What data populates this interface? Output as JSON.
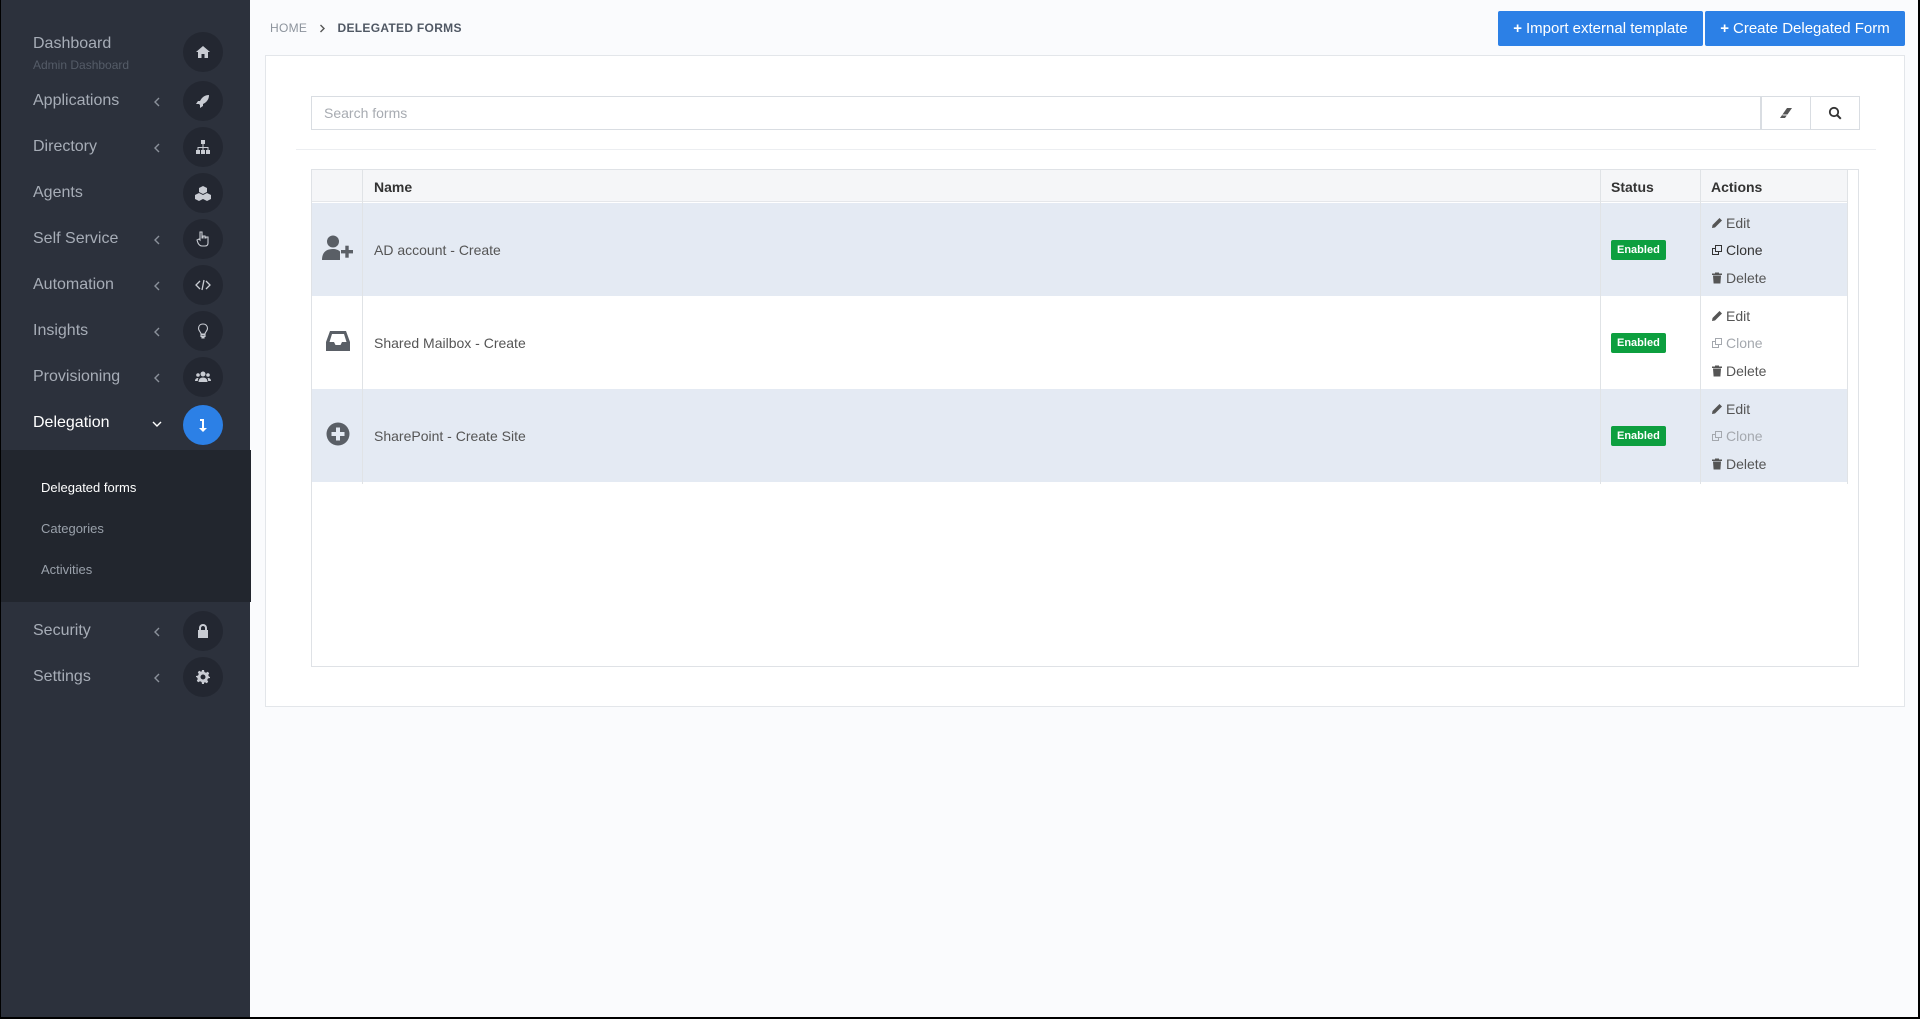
{
  "sidebar": {
    "dashboard": {
      "label": "Dashboard",
      "sub": "Admin Dashboard"
    },
    "items": [
      {
        "label": "Applications",
        "icon": "rocket-icon"
      },
      {
        "label": "Directory",
        "icon": "sitemap-icon"
      },
      {
        "label": "Agents",
        "icon": "cubes-icon"
      },
      {
        "label": "Self Service",
        "icon": "hand-pointer-icon"
      },
      {
        "label": "Automation",
        "icon": "code-icon"
      },
      {
        "label": "Insights",
        "icon": "lightbulb-icon"
      },
      {
        "label": "Provisioning",
        "icon": "users-icon"
      },
      {
        "label": "Delegation",
        "icon": "level-down-icon"
      },
      {
        "label": "Security",
        "icon": "lock-icon"
      },
      {
        "label": "Settings",
        "icon": "gear-icon"
      }
    ],
    "submenu": [
      "Delegated forms",
      "Categories",
      "Activities"
    ]
  },
  "breadcrumb": {
    "home": "HOME",
    "current": "DELEGATED FORMS"
  },
  "buttons": {
    "import": "Import external template",
    "create": "Create Delegated Form"
  },
  "search": {
    "placeholder": "Search forms",
    "value": ""
  },
  "table": {
    "headers": {
      "name": "Name",
      "status": "Status",
      "actions": "Actions"
    },
    "rows": [
      {
        "name": "AD account - Create",
        "status": "Enabled",
        "icon": "user-plus-icon",
        "clone_enabled": true
      },
      {
        "name": "Shared Mailbox - Create",
        "status": "Enabled",
        "icon": "inbox-icon",
        "clone_enabled": false
      },
      {
        "name": "SharePoint - Create Site",
        "status": "Enabled",
        "icon": "plus-circle-icon",
        "clone_enabled": false
      }
    ],
    "actions": {
      "edit": "Edit",
      "clone": "Clone",
      "delete": "Delete"
    }
  },
  "colors": {
    "accent": "#2c80e6",
    "sidebar": "#2c313c",
    "enabled": "#0d9f3f"
  }
}
